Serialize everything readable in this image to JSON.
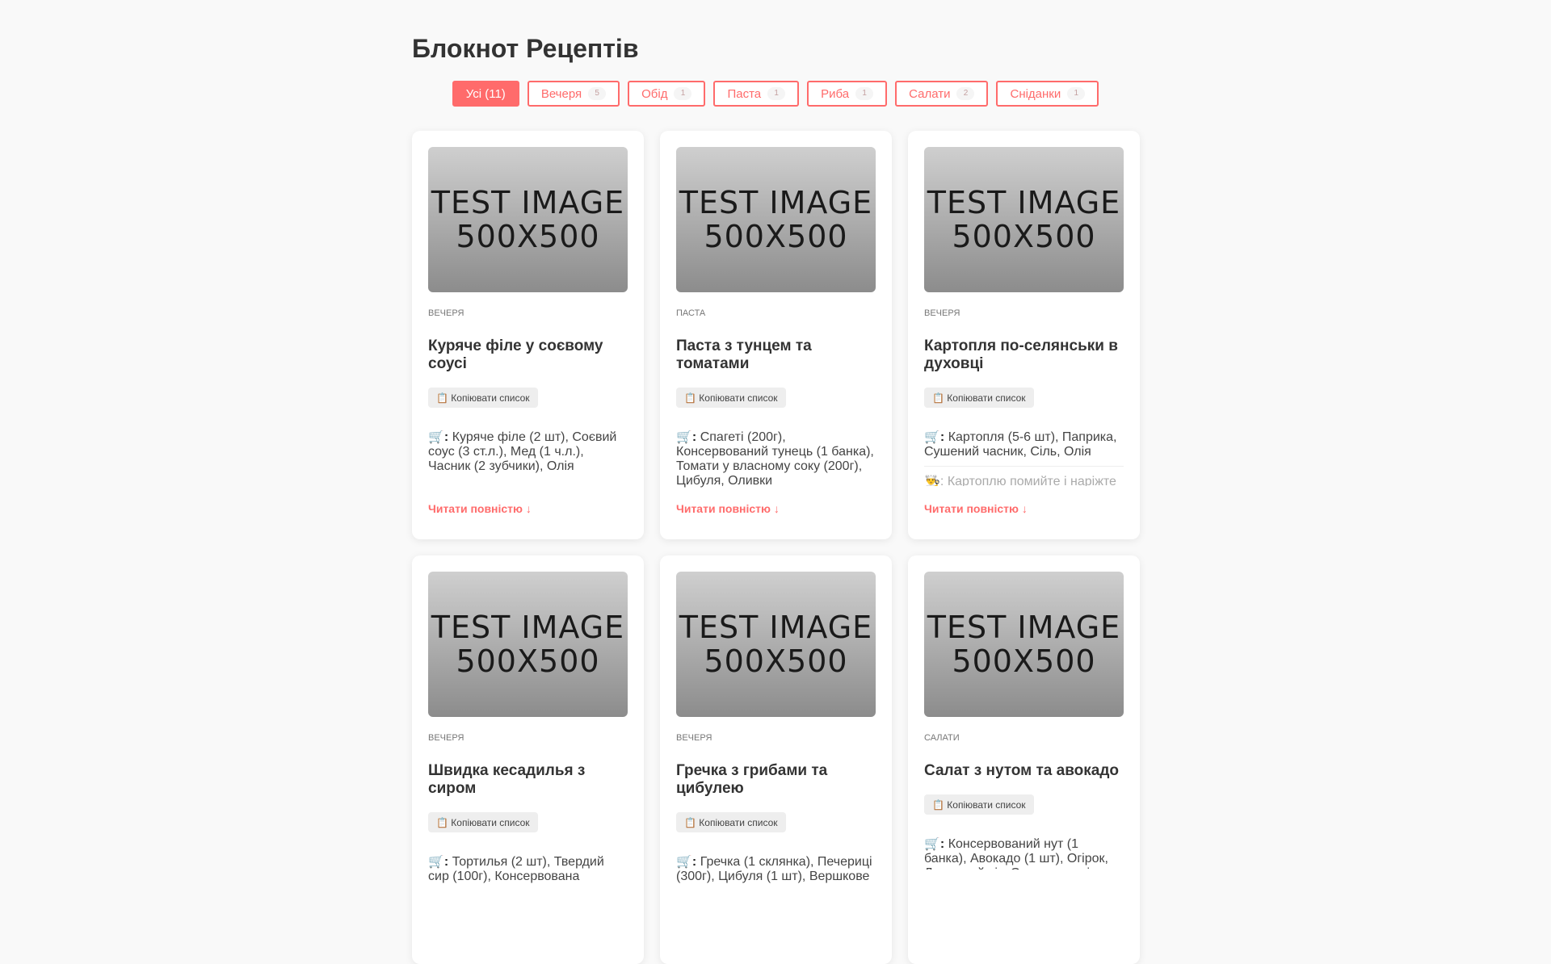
{
  "page": {
    "title": "Блокнот Рецептів"
  },
  "filters": [
    {
      "label": "Усі (11)",
      "count": "",
      "active": true
    },
    {
      "label": "Вечеря",
      "count": "5",
      "active": false
    },
    {
      "label": "Обід",
      "count": "1",
      "active": false
    },
    {
      "label": "Паста",
      "count": "1",
      "active": false
    },
    {
      "label": "Риба",
      "count": "1",
      "active": false
    },
    {
      "label": "Салати",
      "count": "2",
      "active": false
    },
    {
      "label": "Сніданки",
      "count": "1",
      "active": false
    }
  ],
  "common": {
    "image_text": "TEST IMAGE 500X500",
    "copy_label": "📋 Копіювати список",
    "read_more": "Читати повністю ↓",
    "cart_icon": "🛒",
    "colon": ":",
    "step_icon": "👨‍🍳"
  },
  "cards": [
    {
      "category": "Вечеря",
      "title": "Куряче філе у соєвому соусі",
      "ingredients": "Куряче філе (2 шт), Соєвий соус (3 ст.л.), Мед (1 ч.л.), Часник (2 зубчики), Олія"
    },
    {
      "category": "Паста",
      "title": "Паста з тунцем та томатами",
      "ingredients": "Спагеті (200г), Консервований тунець (1 банка), Томати у власному соку (200г), Цибуля, Оливки"
    },
    {
      "category": "Вечеря",
      "title": "Картопля по-селянськи в духовці",
      "ingredients": "Картопля (5-6 шт), Паприка, Сушений часник, Сіль, Олія",
      "step": "Картоплю помийте і наріжте"
    },
    {
      "category": "Вечеря",
      "title": "Швидка кесадилья з сиром",
      "ingredients": "Тортилья (2 шт), Твердий сир (100г), Консервована"
    },
    {
      "category": "Вечеря",
      "title": "Гречка з грибами та цибулею",
      "ingredients": "Гречка (1 склянка), Печериці (300г), Цибуля (1 шт), Вершкове"
    },
    {
      "category": "Салати",
      "title": "Салат з нутом та авокадо",
      "ingredients": "Консервований нут (1 банка), Авокадо (1 шт), Огірок, Лимонний сік, Оливкова олія"
    }
  ]
}
